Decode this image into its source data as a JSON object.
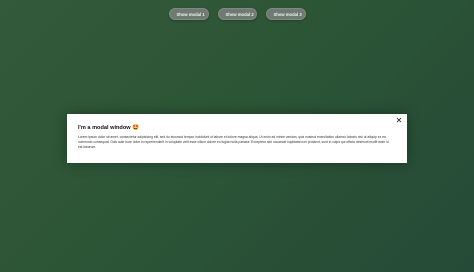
{
  "buttons": [
    {
      "label": "Show modal 1"
    },
    {
      "label": "Show modal 2"
    },
    {
      "label": "Show modal 3"
    }
  ],
  "modal": {
    "title": "I'm a modal window 🤩",
    "body": "Lorem ipsum dolor sit amet, consectetur adipisicing elit, sed do eiusmod tempor incididunt ut labore et dolore magna aliqua. Ut enim ad minim veniam, quis nostrud exercitation ullamco laboris nisi ut aliquip ex ea commodo consequat. Duis aute irure dolor in reprehenderit in voluptate velit esse cillum dolore eu fugiat nulla pariatur. Excepteur sint occaecat cupidatat non proident, sunt in culpa qui officia deserunt mollit anim id est laborum.",
    "close_icon": "close-icon",
    "close_glyph": "✕"
  },
  "colors": {
    "background_start": "#335a3a",
    "background_end": "#254a37",
    "button_bg": "#6f7a72",
    "modal_bg": "#ffffff"
  }
}
